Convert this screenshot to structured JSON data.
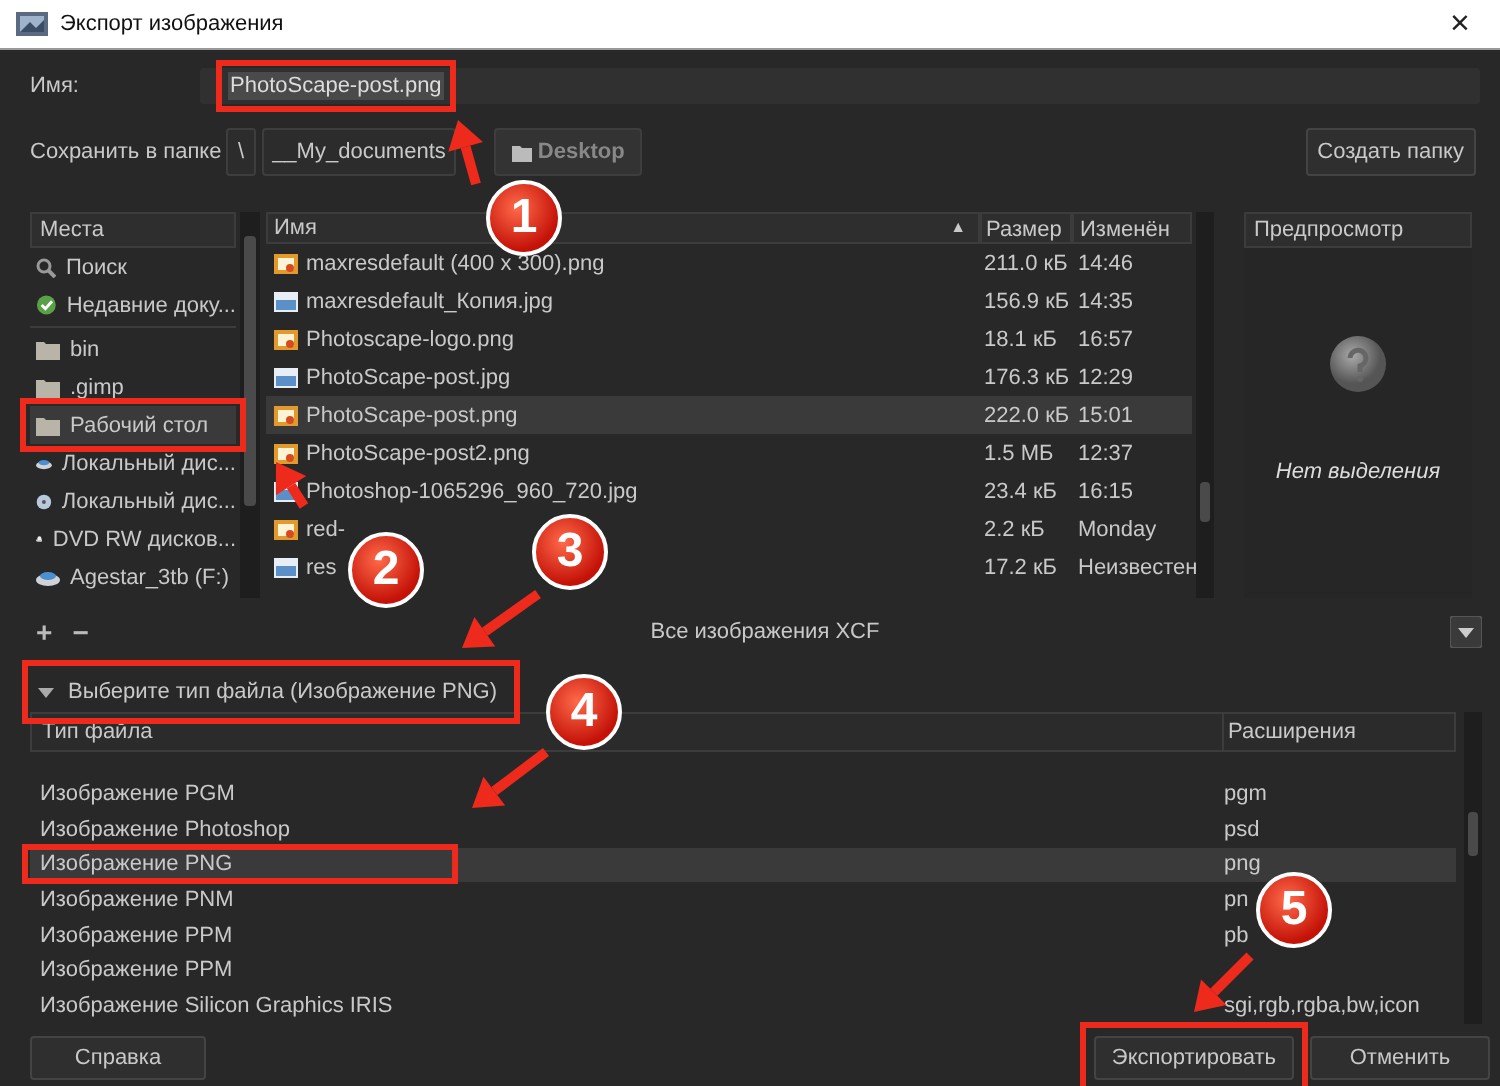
{
  "window": {
    "title": "Экспорт изображения",
    "close": "×"
  },
  "name_row": {
    "label": "Имя:",
    "value": "PhotoScape-post.png"
  },
  "folder_row": {
    "label": "Сохранить в папке",
    "path": [
      {
        "label": "\\",
        "kind": "root"
      },
      {
        "label": "__My_documents",
        "kind": "plain"
      },
      {
        "label": "Desktop",
        "kind": "current"
      }
    ],
    "create_button": "Создать папку"
  },
  "places": {
    "header": "Места",
    "items": [
      {
        "label": "Поиск",
        "kind": "search",
        "selected": false
      },
      {
        "label": "Недавние доку...",
        "kind": "recent",
        "selected": false
      },
      {
        "label": "bin",
        "kind": "folder",
        "selected": false
      },
      {
        "label": ".gimp",
        "kind": "folder",
        "selected": false
      },
      {
        "label": "Рабочий стол",
        "kind": "folder",
        "selected": true
      },
      {
        "label": "Локальный дис...",
        "kind": "drive",
        "selected": false
      },
      {
        "label": "Локальный дис...",
        "kind": "disk",
        "selected": false
      },
      {
        "label": "DVD RW дисков...",
        "kind": "dvd",
        "selected": false
      },
      {
        "label": "Agestar_3tb (F:)",
        "kind": "drive",
        "selected": false
      }
    ],
    "add": "+",
    "remove": "−"
  },
  "files": {
    "columns": [
      "Имя",
      "Размер",
      "Изменён"
    ],
    "sort": "▲",
    "rows": [
      {
        "name": "maxresdefault (400 x 300).png",
        "kind": "png",
        "size": "211.0 кБ",
        "modified": "14:46",
        "selected": false
      },
      {
        "name": "maxresdefault_Копия.jpg",
        "kind": "jpg",
        "size": "156.9 кБ",
        "modified": "14:35",
        "selected": false
      },
      {
        "name": "Photoscape-logo.png",
        "kind": "png",
        "size": "18.1 кБ",
        "modified": "16:57",
        "selected": false
      },
      {
        "name": "PhotoScape-post.jpg",
        "kind": "jpg",
        "size": "176.3 кБ",
        "modified": "12:29",
        "selected": false
      },
      {
        "name": "PhotoScape-post.png",
        "kind": "png",
        "size": "222.0 кБ",
        "modified": "15:01",
        "selected": true
      },
      {
        "name": "PhotoScape-post2.png",
        "kind": "png",
        "size": "1.5 МБ",
        "modified": "12:37",
        "selected": false
      },
      {
        "name": "Photoshop-1065296_960_720.jpg",
        "kind": "jpg",
        "size": "23.4 кБ",
        "modified": "16:15",
        "selected": false
      },
      {
        "name": "red-",
        "kind": "png",
        "size": "2.2 кБ",
        "modified": "Monday",
        "selected": false
      },
      {
        "name": "res",
        "kind": "jpg",
        "size": "17.2 кБ",
        "modified": "Неизвестен",
        "selected": false
      }
    ]
  },
  "preview": {
    "header": "Предпросмотр",
    "message": "Нет выделения"
  },
  "filter": {
    "value": "Все изображения XCF"
  },
  "file_type": {
    "expander": "Выберите тип файла (Изображение PNG)",
    "expanded": true,
    "columns": [
      "Тип файла",
      "Расширения"
    ],
    "rows": [
      {
        "name": "Изображение PGM",
        "ext": "pgm",
        "selected": false
      },
      {
        "name": "Изображение Photoshop",
        "ext": "psd",
        "selected": false
      },
      {
        "name": "Изображение PNG",
        "ext": "png",
        "selected": true
      },
      {
        "name": "Изображение PNM",
        "ext": "pn",
        "selected": false
      },
      {
        "name": "Изображение PPM",
        "ext": "pb",
        "selected": false
      },
      {
        "name": "Изображение PPM",
        "selected": false
      },
      {
        "name": "Изображение Silicon Graphics IRIS",
        "ext": "sgi,rgb,rgba,bw,icon",
        "selected": false
      }
    ]
  },
  "buttons": [
    {
      "label": "Справка",
      "kind": "help"
    },
    {
      "label": "Экспортировать",
      "kind": "export"
    },
    {
      "label": "Отменить",
      "kind": "cancel"
    }
  ],
  "annotations": [
    {
      "number": "1"
    },
    {
      "number": "2"
    },
    {
      "number": "3"
    },
    {
      "number": "4"
    },
    {
      "number": "5"
    }
  ]
}
